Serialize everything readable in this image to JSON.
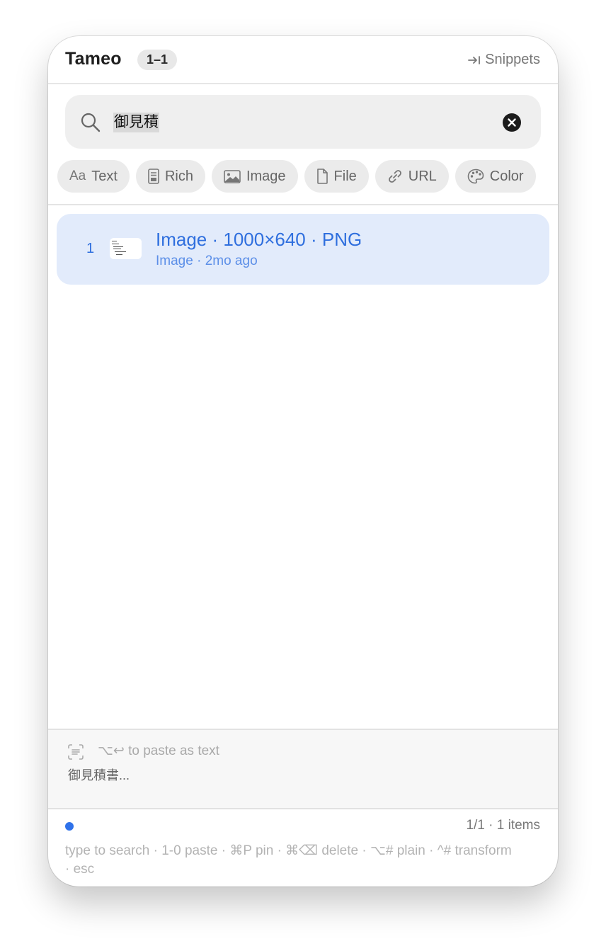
{
  "app": {
    "title": "Tameo",
    "range_badge": "1–1",
    "snippets_label": "Snippets"
  },
  "search": {
    "value": "御見積",
    "clear_icon": "clear-icon"
  },
  "filters": [
    {
      "label": "Text",
      "icon": "aa-icon"
    },
    {
      "label": "Rich",
      "icon": "rich-text-icon"
    },
    {
      "label": "Image",
      "icon": "image-icon"
    },
    {
      "label": "File",
      "icon": "file-icon"
    },
    {
      "label": "URL",
      "icon": "link-icon"
    },
    {
      "label": "Color",
      "icon": "palette-icon"
    }
  ],
  "results": [
    {
      "index": "1",
      "title": "Image · 1000×640 · PNG",
      "subtitle": "Image · 2mo ago"
    }
  ],
  "preview": {
    "hint": "⌥↩ to paste as text",
    "text": "御見積書..."
  },
  "footer": {
    "counts": "1/1 · 1 items",
    "shortcuts": "type to search · 1-0 paste · ⌘P pin · ⌘⌫ delete · ⌥# plain · ^# transform · esc"
  },
  "colors": {
    "accent": "#2f6fde",
    "selected_row": "#e2ebfb",
    "status_dot": "#2f72ea"
  }
}
